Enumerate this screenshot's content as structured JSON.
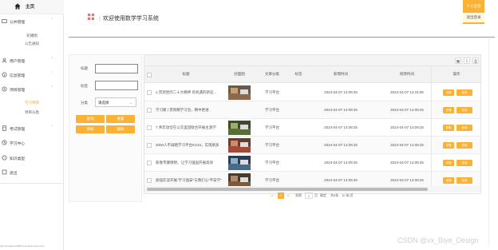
{
  "brand": {
    "title": "主页",
    "icon": "home-icon"
  },
  "header": {
    "title": "欢迎使用数学学习系统",
    "icon": "grid-icon",
    "user_center": "个人信息",
    "home_btn": "退出登录"
  },
  "sidebar": {
    "items": [
      {
        "label": "公共管理",
        "icon": "folder-icon",
        "subs": [
          "轮播图",
          "公告通知"
        ]
      },
      {
        "label": "用户管理",
        "icon": "user-icon"
      },
      {
        "label": "信息管理",
        "icon": "info-icon"
      },
      {
        "label": "项目管理",
        "icon": "project-icon",
        "subs": [
          "学习项目",
          "项目分类"
        ]
      },
      {
        "label": "考试管理",
        "icon": "exam-icon"
      },
      {
        "label": "学习中心",
        "icon": "study-icon"
      },
      {
        "label": "知识类型",
        "icon": "knowledge-icon"
      },
      {
        "label": "退出",
        "icon": "exit-icon"
      }
    ]
  },
  "status_url": "http://localhost:8080/xxx/admin/index.html",
  "search": {
    "title_label": "标题",
    "title_value": "",
    "tag_label": "标签",
    "tag_value": "",
    "category_label": "分类",
    "category_value": "请选择",
    "btn_search": "查询",
    "btn_reset": "重置",
    "btn_add": "添加",
    "btn_delete": "删除"
  },
  "table": {
    "columns": [
      "标题",
      "封面图",
      "文章分类",
      "标签",
      "新增时间",
      "修改时间",
      "操作"
    ],
    "rows": [
      {
        "title": "1 贯彻党的二十大精神 有机遇的新征...",
        "category": "学习平台",
        "tag": "",
        "created": "2024-04-07 14:09:25",
        "updated": "2024-04-07 14:15:05",
        "thumb": true
      },
      {
        "title": "学习路 | 贯彻精学习治，精中更进",
        "category": "学习平台",
        "tag": "",
        "created": "2024-04-07 14:09:25",
        "updated": "2024-04-07 14:09:25",
        "thumb": false
      },
      {
        "title": "7 青年攻坚在公交里团联合开展主演学",
        "category": "学习平台",
        "tag": "",
        "created": "2024-04-07 14:09:25",
        "updated": "2024-04-07 14:09:25",
        "thumb": true
      },
      {
        "title": "3000人不再晒学习平台KS10，实现刷多",
        "category": "学习平台",
        "tag": "",
        "created": "2024-04-07 14:09:25",
        "updated": "2024-04-07 14:09:25",
        "thumb": true
      },
      {
        "title": "新春市健德阴，让学习强国开展高效",
        "category": "学习平台",
        "tag": "",
        "created": "2024-04-07 14:09:25",
        "updated": "2024-04-07 14:09:25",
        "thumb": true
      },
      {
        "title": "加强在读开展\"学习强安\"与我们心\"平安学\"",
        "category": "学习平台",
        "tag": "",
        "created": "2024-04-07 14:09:25",
        "updated": "2024-04-07 14:09:25",
        "thumb": true
      }
    ],
    "action_edit": "详情",
    "action_delete": "修改"
  },
  "pager": {
    "prev": "<",
    "current": "1",
    "next": ">",
    "goto": "到第",
    "page_input": "1",
    "page_unit": "页",
    "confirm": "确定",
    "total": "共6条",
    "per_page": "10 条/页"
  },
  "watermark": "CSDN @vx_Biye_Design",
  "colors": {
    "accent": "#f9b233"
  }
}
